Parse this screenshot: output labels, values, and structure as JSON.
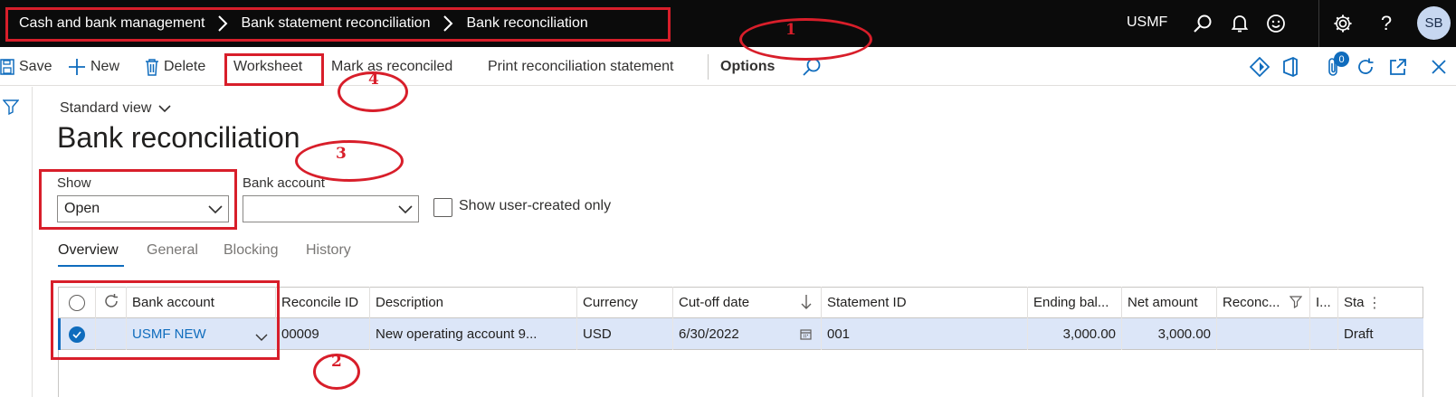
{
  "breadcrumb": [
    "Cash and bank management",
    "Bank statement reconciliation",
    "Bank reconciliation"
  ],
  "topbar": {
    "company": "USMF",
    "avatar_initials": "SB"
  },
  "actions": {
    "save": "Save",
    "new": "New",
    "delete": "Delete",
    "worksheet": "Worksheet",
    "mark_reconciled": "Mark as reconciled",
    "print_statement": "Print reconciliation statement",
    "options": "Options",
    "attachments_count": "0"
  },
  "view": {
    "selector": "Standard view"
  },
  "page": {
    "title": "Bank reconciliation"
  },
  "filters": {
    "show_label": "Show",
    "show_value": "Open",
    "bank_account_label": "Bank account",
    "bank_account_value": "",
    "user_created_label": "Show user-created only",
    "user_created_checked": false
  },
  "tabs": [
    "Overview",
    "General",
    "Blocking",
    "History"
  ],
  "grid": {
    "columns": [
      "Bank account",
      "Reconcile ID",
      "Description",
      "Currency",
      "Cut-off date",
      "Statement ID",
      "Ending bal...",
      "Net amount",
      "Reconc...",
      "I...",
      "Sta"
    ],
    "sort": {
      "column": "Cut-off date",
      "direction": "descending"
    },
    "rows": [
      {
        "selected": true,
        "bank_account": "USMF NEW",
        "reconcile_id": "00009",
        "description": "New operating account 9...",
        "currency": "USD",
        "cutoff_date": "6/30/2022",
        "statement_id": "001",
        "ending_balance": "3,000.00",
        "net_amount": "3,000.00",
        "reconciled": "",
        "i": "",
        "status": "Draft"
      }
    ]
  },
  "annotations": [
    "1",
    "2",
    "3",
    "4"
  ],
  "colors": {
    "accent": "#0f6cbd",
    "annotation": "#d81e2a",
    "topbar": "#0b0b0b",
    "selected_row": "#dce6f8"
  }
}
